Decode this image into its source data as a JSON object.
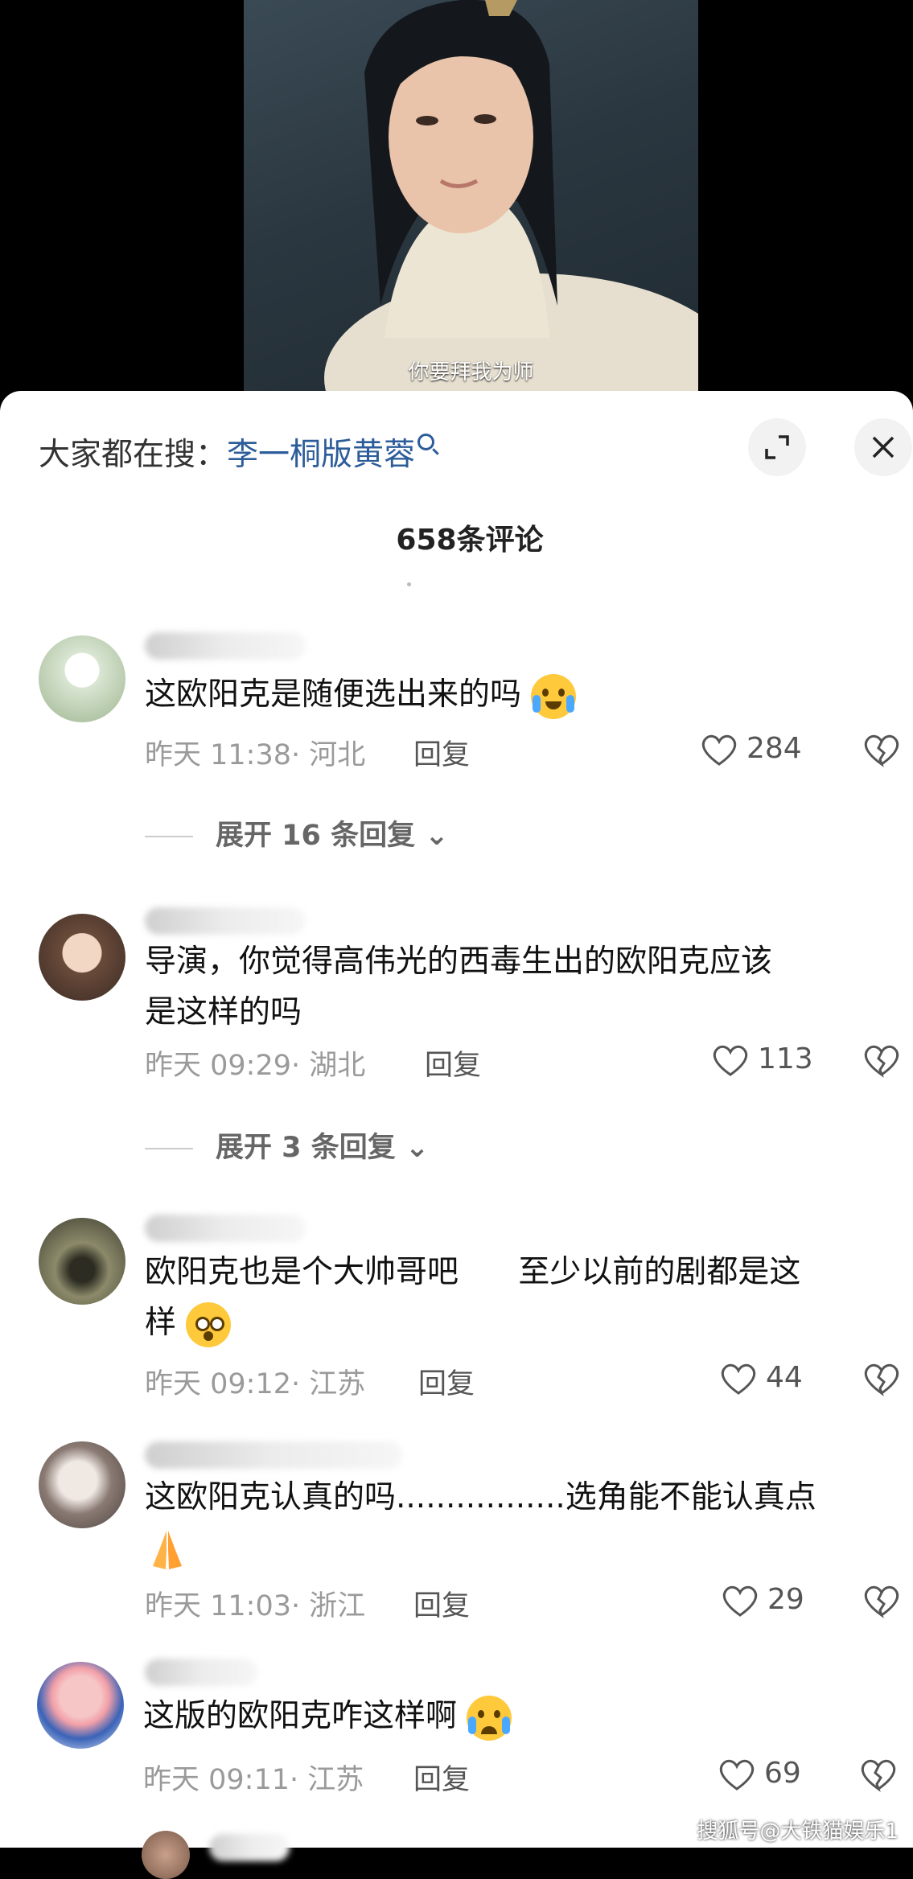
{
  "video": {
    "subtitle": "你要拜我为师"
  },
  "header": {
    "search_prefix": "大家都在搜：",
    "search_term": "李一桐版黄蓉",
    "comment_count": "658条评论"
  },
  "comments": [
    {
      "text": "这欧阳克是随便选出来的吗",
      "time": "昨天 11:38",
      "location": "· 河北",
      "reply_label": "回复",
      "likes": "284",
      "expand_label": "展开 16 条回复"
    },
    {
      "text_line1": "导演，你觉得高伟光的西毒生出的欧阳克应该",
      "text_line2": "是这样的吗",
      "time": "昨天 09:29",
      "location": "· 湖北",
      "reply_label": "回复",
      "likes": "113",
      "expand_label": "展开 3 条回复"
    },
    {
      "text_line1": "欧阳克也是个大帅哥吧      至少以前的剧都是这",
      "text_line2": "样",
      "time": "昨天 09:12",
      "location": "· 江苏",
      "reply_label": "回复",
      "likes": "44"
    },
    {
      "text": "这欧阳克认真的吗.................选角能不能认真点",
      "time": "昨天 11:03",
      "location": "· 浙江",
      "reply_label": "回复",
      "likes": "29"
    },
    {
      "text": "这版的欧阳克咋这样啊",
      "time": "昨天 09:11",
      "location": "· 江苏",
      "reply_label": "回复",
      "likes": "69"
    }
  ],
  "watermark": "搜狐号@大铁猫娱乐1",
  "colors": {
    "link": "#2c5d9a",
    "meta": "#9a9a9a",
    "emoji": "#ffc93c"
  }
}
